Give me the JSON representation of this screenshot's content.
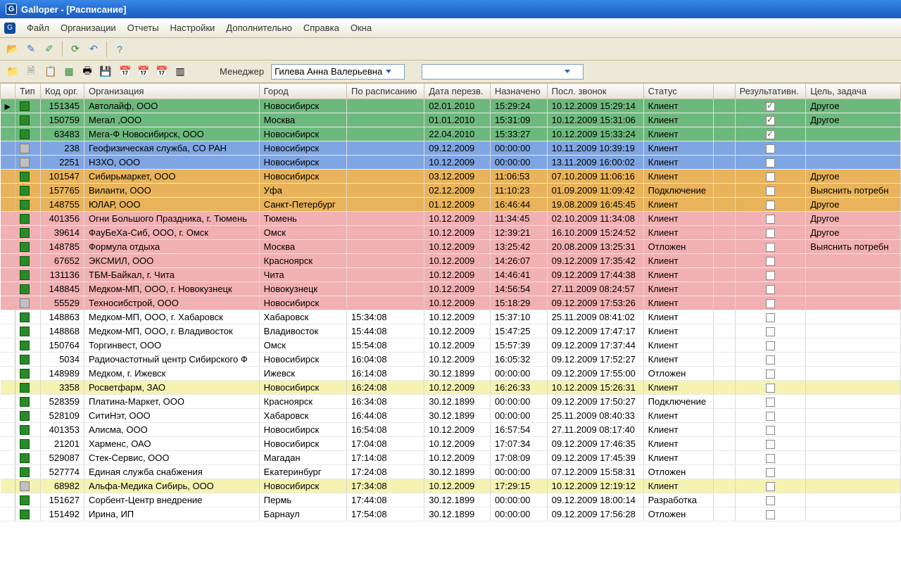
{
  "titlebar": {
    "text": "Galloper - [Расписание]"
  },
  "menu": [
    "Файл",
    "Организации",
    "Отчеты",
    "Настройки",
    "Дополнительно",
    "Справка",
    "Окна"
  ],
  "toolbar2": {
    "manager_label": "Менеджер",
    "manager_value": "Гилева Анна Валерьевна"
  },
  "columns": [
    "",
    "Тип",
    "Код орг.",
    "Организация",
    "Город",
    "По расписанию",
    "Дата перезв.",
    "Назначено",
    "Посл. звонок",
    "Статус",
    "",
    "Результативн.",
    "Цель, задача"
  ],
  "rows": [
    {
      "c": "green",
      "sel": true,
      "icon": "org",
      "code": "151345",
      "org": "Автолайф, ООО",
      "city": "Новосибирск",
      "sched": "",
      "date": "02.01.2010",
      "time": "15:29:24",
      "last": "10.12.2009 15:29:14",
      "status": "Клиент",
      "chk": true,
      "goal": "Другое"
    },
    {
      "c": "green",
      "icon": "org",
      "code": "150759",
      "org": "Мегал ,ООО",
      "city": "Москва",
      "sched": "",
      "date": "01.01.2010",
      "time": "15:31:09",
      "last": "10.12.2009 15:31:06",
      "status": "Клиент",
      "chk": true,
      "goal": "Другое"
    },
    {
      "c": "green",
      "icon": "org",
      "code": "63483",
      "org": "Мега-Ф Новосибирск, ООО",
      "city": "Новосибирск",
      "sched": "",
      "date": "22.04.2010",
      "time": "15:33:27",
      "last": "10.12.2009 15:33:24",
      "status": "Клиент",
      "chk": true,
      "goal": ""
    },
    {
      "c": "blue",
      "icon": "doc",
      "code": "238",
      "org": "Геофизическая служба, СО РАН",
      "city": "Новосибирск",
      "sched": "",
      "date": "09.12.2009",
      "time": "00:00:00",
      "last": "10.11.2009 10:39:19",
      "status": "Клиент",
      "chk": false,
      "goal": ""
    },
    {
      "c": "blue",
      "icon": "doc",
      "code": "2251",
      "org": "НЗХО, ООО",
      "city": "Новосибирск",
      "sched": "",
      "date": "10.12.2009",
      "time": "00:00:00",
      "last": "13.11.2009 16:00:02",
      "status": "Клиент",
      "chk": false,
      "goal": ""
    },
    {
      "c": "orange",
      "icon": "org",
      "code": "101547",
      "org": "Сибирьмаркет, ООО",
      "city": "Новосибирск",
      "sched": "",
      "date": "03.12.2009",
      "time": "11:06:53",
      "last": "07.10.2009 11:06:16",
      "status": "Клиент",
      "chk": false,
      "goal": "Другое"
    },
    {
      "c": "orange",
      "icon": "org",
      "code": "157765",
      "org": "Виланти, ООО",
      "city": "Уфа",
      "sched": "",
      "date": "02.12.2009",
      "time": "11:10:23",
      "last": "01.09.2009 11:09:42",
      "status": "Подключение",
      "chk": false,
      "goal": "Выяснить потребн"
    },
    {
      "c": "orange",
      "icon": "org",
      "code": "148755",
      "org": "ЮЛАР, ООО",
      "city": "Санкт-Петербург",
      "sched": "",
      "date": "01.12.2009",
      "time": "16:46:44",
      "last": "19.08.2009 16:45:45",
      "status": "Клиент",
      "chk": false,
      "goal": "Другое"
    },
    {
      "c": "pink",
      "icon": "org",
      "code": "401356",
      "org": "Огни Большого Праздника, г. Тюмень",
      "city": "Тюмень",
      "sched": "",
      "date": "10.12.2009",
      "time": "11:34:45",
      "last": "02.10.2009 11:34:08",
      "status": "Клиент",
      "chk": false,
      "goal": "Другое"
    },
    {
      "c": "pink",
      "icon": "org",
      "code": "39614",
      "org": "ФауБеХа-Сиб, ООО, г. Омск",
      "city": "Омск",
      "sched": "",
      "date": "10.12.2009",
      "time": "12:39:21",
      "last": "16.10.2009 15:24:52",
      "status": "Клиент",
      "chk": false,
      "goal": "Другое"
    },
    {
      "c": "pink",
      "icon": "org",
      "code": "148785",
      "org": "Формула отдыха",
      "city": "Москва",
      "sched": "",
      "date": "10.12.2009",
      "time": "13:25:42",
      "last": "20.08.2009 13:25:31",
      "status": "Отложен",
      "chk": false,
      "goal": "Выяснить потребн"
    },
    {
      "c": "pink",
      "icon": "org",
      "code": "67652",
      "org": "ЭКСМИЛ, ООО",
      "city": "Красноярск",
      "sched": "",
      "date": "10.12.2009",
      "time": "14:26:07",
      "last": "09.12.2009 17:35:42",
      "status": "Клиент",
      "chk": false,
      "goal": ""
    },
    {
      "c": "pink",
      "icon": "org",
      "code": "131136",
      "org": "ТБМ-Байкал, г. Чита",
      "city": "Чита",
      "sched": "",
      "date": "10.12.2009",
      "time": "14:46:41",
      "last": "09.12.2009 17:44:38",
      "status": "Клиент",
      "chk": false,
      "goal": ""
    },
    {
      "c": "pink",
      "icon": "org",
      "code": "148845",
      "org": "Медком-МП, ООО, г. Новокузнецк",
      "city": "Новокузнецк",
      "sched": "",
      "date": "10.12.2009",
      "time": "14:56:54",
      "last": "27.11.2009 08:24:57",
      "status": "Клиент",
      "chk": false,
      "goal": ""
    },
    {
      "c": "pink",
      "icon": "doc",
      "code": "55529",
      "org": "Техносибстрой, ООО",
      "city": "Новосибирск",
      "sched": "",
      "date": "10.12.2009",
      "time": "15:18:29",
      "last": "09.12.2009 17:53:26",
      "status": "Клиент",
      "chk": false,
      "goal": ""
    },
    {
      "c": "plain",
      "icon": "org",
      "code": "148863",
      "org": "Медком-МП, ООО,  г. Хабаровск",
      "city": "Хабаровск",
      "sched": "15:34:08",
      "date": "10.12.2009",
      "time": "15:37:10",
      "last": "25.11.2009 08:41:02",
      "status": "Клиент",
      "chk": false,
      "goal": ""
    },
    {
      "c": "plain",
      "icon": "org",
      "code": "148868",
      "org": "Медком-МП, ООО, г. Владивосток",
      "city": "Владивосток",
      "sched": "15:44:08",
      "date": "10.12.2009",
      "time": "15:47:25",
      "last": "09.12.2009 17:47:17",
      "status": "Клиент",
      "chk": false,
      "goal": ""
    },
    {
      "c": "plain",
      "icon": "org",
      "code": "150764",
      "org": "Торгинвест, ООО",
      "city": "Омск",
      "sched": "15:54:08",
      "date": "10.12.2009",
      "time": "15:57:39",
      "last": "09.12.2009 17:37:44",
      "status": "Клиент",
      "chk": false,
      "goal": ""
    },
    {
      "c": "plain",
      "icon": "org",
      "code": "5034",
      "org": "Радиочастотный центр Сибирского Ф",
      "city": "Новосибирск",
      "sched": "16:04:08",
      "date": "10.12.2009",
      "time": "16:05:32",
      "last": "09.12.2009 17:52:27",
      "status": "Клиент",
      "chk": false,
      "goal": ""
    },
    {
      "c": "plain",
      "icon": "org",
      "code": "148989",
      "org": "Медком, г. Ижевск",
      "city": "Ижевск",
      "sched": "16:14:08",
      "date": "30.12.1899",
      "time": "00:00:00",
      "last": "09.12.2009 17:55:00",
      "status": "Отложен",
      "chk": false,
      "goal": ""
    },
    {
      "c": "yellow",
      "icon": "org",
      "code": "3358",
      "org": "Росветфарм, ЗАО",
      "city": "Новосибирск",
      "sched": "16:24:08",
      "date": "10.12.2009",
      "time": "16:26:33",
      "last": "10.12.2009 15:26:31",
      "status": "Клиент",
      "chk": false,
      "goal": ""
    },
    {
      "c": "plain",
      "icon": "org",
      "code": "528359",
      "org": "Платина-Маркет, ООО",
      "city": "Красноярск",
      "sched": "16:34:08",
      "date": "30.12.1899",
      "time": "00:00:00",
      "last": "09.12.2009 17:50:27",
      "status": "Подключение",
      "chk": false,
      "goal": ""
    },
    {
      "c": "plain",
      "icon": "org",
      "code": "528109",
      "org": "СитиНэт, ООО",
      "city": "Хабаровск",
      "sched": "16:44:08",
      "date": "30.12.1899",
      "time": "00:00:00",
      "last": "25.11.2009 08:40:33",
      "status": "Клиент",
      "chk": false,
      "goal": ""
    },
    {
      "c": "plain",
      "icon": "org",
      "code": "401353",
      "org": "Алисма, ООО",
      "city": "Новосибирск",
      "sched": "16:54:08",
      "date": "10.12.2009",
      "time": "16:57:54",
      "last": "27.11.2009 08:17:40",
      "status": "Клиент",
      "chk": false,
      "goal": ""
    },
    {
      "c": "plain",
      "icon": "org",
      "code": "21201",
      "org": "Харменс, ОАО",
      "city": "Новосибирск",
      "sched": "17:04:08",
      "date": "10.12.2009",
      "time": "17:07:34",
      "last": "09.12.2009 17:46:35",
      "status": "Клиент",
      "chk": false,
      "goal": ""
    },
    {
      "c": "plain",
      "icon": "org",
      "code": "529087",
      "org": "Стек-Сервис, ООО",
      "city": "Магадан",
      "sched": "17:14:08",
      "date": "10.12.2009",
      "time": "17:08:09",
      "last": "09.12.2009 17:45:39",
      "status": "Клиент",
      "chk": false,
      "goal": ""
    },
    {
      "c": "plain",
      "icon": "org",
      "code": "527774",
      "org": "Единая служба снабжения",
      "city": "Екатеринбург",
      "sched": "17:24:08",
      "date": "30.12.1899",
      "time": "00:00:00",
      "last": "07.12.2009 15:58:31",
      "status": "Отложен",
      "chk": false,
      "goal": ""
    },
    {
      "c": "yellow",
      "icon": "doc",
      "code": "68982",
      "org": "Альфа-Медика Сибирь, ООО",
      "city": "Новосибирск",
      "sched": "17:34:08",
      "date": "10.12.2009",
      "time": "17:29:15",
      "last": "10.12.2009 12:19:12",
      "status": "Клиент",
      "chk": false,
      "goal": ""
    },
    {
      "c": "plain",
      "icon": "org",
      "code": "151627",
      "org": "Сорбент-Центр внедрение",
      "city": "Пермь",
      "sched": "17:44:08",
      "date": "30.12.1899",
      "time": "00:00:00",
      "last": "09.12.2009 18:00:14",
      "status": "Разработка",
      "chk": false,
      "goal": ""
    },
    {
      "c": "plain",
      "icon": "org",
      "code": "151492",
      "org": "Ирина, ИП",
      "city": "Барнаул",
      "sched": "17:54:08",
      "date": "30.12.1899",
      "time": "00:00:00",
      "last": "09.12.2009 17:56:28",
      "status": "Отложен",
      "chk": false,
      "goal": ""
    }
  ]
}
